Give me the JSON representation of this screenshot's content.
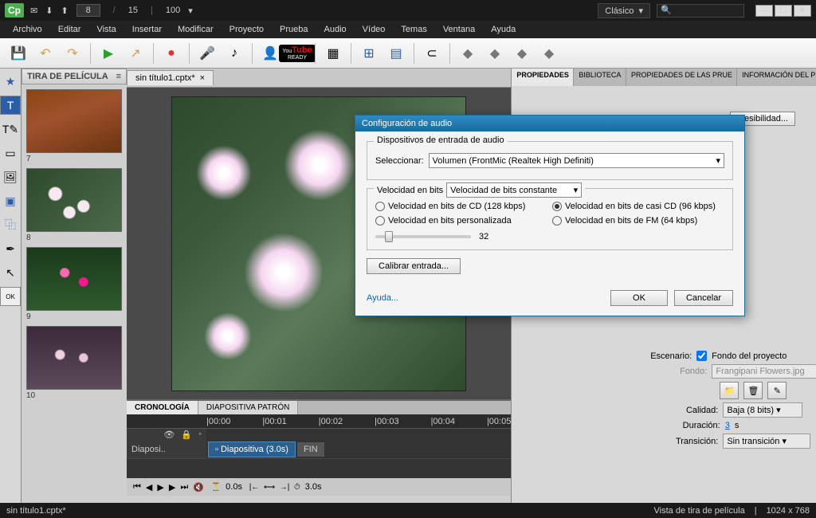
{
  "titlebar": {
    "page_current": "8",
    "page_total": "15",
    "zoom": "100",
    "workspace": "Clásico"
  },
  "menu": [
    "Archivo",
    "Editar",
    "Vista",
    "Insertar",
    "Modificar",
    "Proyecto",
    "Prueba",
    "Audio",
    "Vídeo",
    "Temas",
    "Ventana",
    "Ayuda"
  ],
  "doc_tab": "sin título1.cptx*",
  "filmstrip": {
    "title": "TIRA DE PELÍCULA",
    "thumbs": [
      "7",
      "8",
      "9",
      "10"
    ]
  },
  "timeline": {
    "tab1": "CRONOLOGÍA",
    "tab2": "DIAPOSITIVA PATRÓN",
    "ticks": [
      "|00:00",
      "|00:01",
      "|00:02",
      "|00:03",
      "|00:04",
      "|00:05"
    ],
    "track_label": "Diaposi..",
    "clip": "Diapositiva (3.0s)",
    "fin": "FIN",
    "time1": "0.0s",
    "time2": "3.0s"
  },
  "rp": {
    "tabs": [
      "PROPIEDADES",
      "BIBLIOTECA",
      "PROPIEDADES DE LAS PRUE",
      "INFORMACIÓN DEL PROYEC"
    ],
    "accessibility": "...esibilidad...",
    "escenario_lbl": "Escenario:",
    "escenario_chk": "Fondo del proyecto",
    "fondo_lbl": "Fondo:",
    "fondo_val": "Frangipani Flowers.jpg",
    "calidad_lbl": "Calidad:",
    "calidad_val": "Baja (8 bits)",
    "duracion_lbl": "Duración:",
    "duracion_val": "3",
    "duracion_unit": " s",
    "transicion_lbl": "Transición:",
    "transicion_val": "Sin transición"
  },
  "status": {
    "file": "sin título1.cptx*",
    "view": "Vista de tira de película",
    "dims": "1024 x 768"
  },
  "dialog": {
    "title": "Configuración de audio",
    "group1": "Dispositivos de entrada de audio",
    "select_lbl": "Seleccionar:",
    "select_val": "Volumen (FrontMic (Realtek High Definiti)",
    "bitrate_lbl": "Velocidad en bits",
    "bitrate_mode": "Velocidad de bits constante",
    "r1": "Velocidad en bits de CD (128 kbps)",
    "r2": "Velocidad en bits de casi CD (96 kbps)",
    "r3": "Velocidad en bits personalizada",
    "r4": "Velocidad en bits de FM (64 kbps)",
    "slider_val": "32",
    "calibrate": "Calibrar entrada...",
    "help": "Ayuda...",
    "ok": "OK",
    "cancel": "Cancelar"
  }
}
